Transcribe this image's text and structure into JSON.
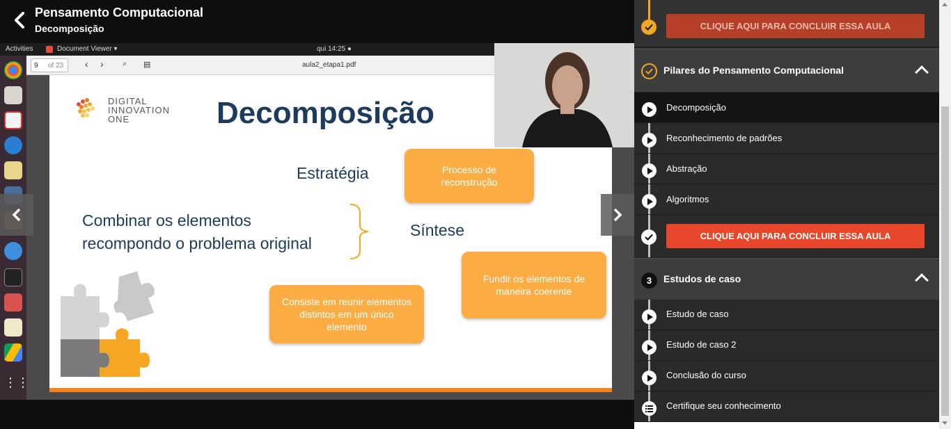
{
  "header": {
    "title": "Pensamento Computacional",
    "subtitle": "Decomposição"
  },
  "desktop": {
    "activities": "Activities",
    "app_name": "Document Viewer ▾",
    "clock": "qui 14:25 ●",
    "page_current": "9",
    "page_total": "of 23",
    "filename": "aula2_etapa1.pdf"
  },
  "slide": {
    "logo_line1": "DIGITAL",
    "logo_line2": "INNOVATION",
    "logo_line3": "ONE",
    "title": "Decomposição",
    "estrategia": "Estratégia",
    "combinar_line1": "Combinar os elementos",
    "combinar_line2": "recompondo o problema original",
    "sintese": "Síntese",
    "box_processo": "Processo de reconstrução",
    "box_fundir": "Fundir os elementos de maneira coerente",
    "box_consiste": "Consiste em reunir elementos distintos em um único elemento"
  },
  "sidebar": {
    "top_conclude": "CLIQUE AQUI PARA CONCLUIR ESSA AULA",
    "section2": {
      "title": "Pilares do Pensamento Computacional",
      "items": [
        "Decomposição",
        "Reconhecimento de padrões",
        "Abstração",
        "Algoritmos"
      ],
      "conclude": "CLIQUE AQUI PARA CONCLUIR ESSA AULA"
    },
    "section3": {
      "number": "3",
      "title": "Estudos de caso",
      "items": [
        "Estudo de caso",
        "Estudo de caso 2",
        "Conclusão do curso",
        "Certifique seu conhecimento"
      ]
    }
  },
  "colors": {
    "accent_orange": "#f5a623",
    "conclude_active": "#e8472b",
    "conclude_dim": "#b5402a"
  }
}
